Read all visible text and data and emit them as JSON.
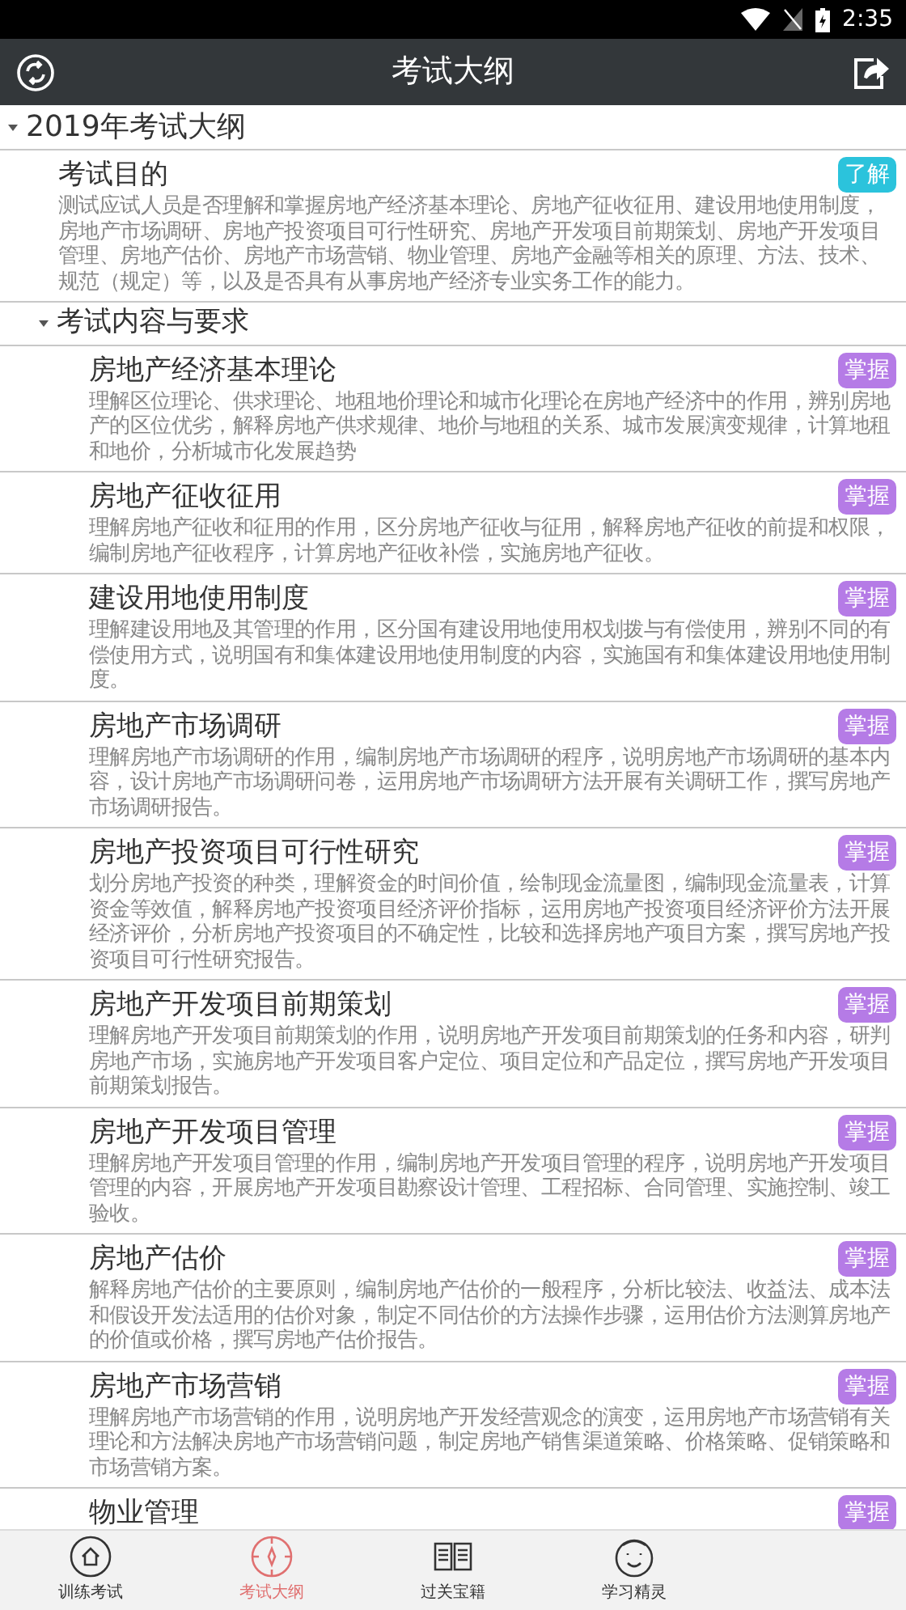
{
  "status_bar": {
    "time": "2:35"
  },
  "toolbar": {
    "title": "考试大纲"
  },
  "outline": [
    {
      "kind": "group",
      "title": "2019年考试大纲",
      "expanded": true,
      "children": [
        {
          "kind": "topic",
          "title": "考试目的",
          "tag": {
            "text": "了解",
            "color": "#2bc3dc"
          },
          "description": "测试应试人员是否理解和掌握房地产经济基本理论、房地产征收征用、建设用地使用制度，房地产市场调研、房地产投资项目可行性研究、房地产开发项目前期策划、房地产开发项目管理、房地产估价、房地产市场营销、物业管理、房地产金融等相关的原理、方法、技术、规范（规定）等，以及是否具有从事房地产经济专业实务工作的能力。"
        },
        {
          "kind": "group",
          "title": "考试内容与要求",
          "expanded": true,
          "children": [
            {
              "kind": "topic",
              "title": "房地产经济基本理论",
              "tag": {
                "text": "掌握",
                "color": "#b57be6"
              },
              "description": "理解区位理论、供求理论、地租地价理论和城市化理论在房地产经济中的作用，辨别房地产的区位优劣，解释房地产供求规律、地价与地租的关系、城市发展演变规律，计算地租和地价，分析城市化发展趋势"
            },
            {
              "kind": "topic",
              "title": "房地产征收征用",
              "tag": {
                "text": "掌握",
                "color": "#b57be6"
              },
              "description": "理解房地产征收和征用的作用，区分房地产征收与征用，解释房地产征收的前提和权限，编制房地产征收程序，计算房地产征收补偿，实施房地产征收。"
            },
            {
              "kind": "topic",
              "title": "建设用地使用制度",
              "tag": {
                "text": "掌握",
                "color": "#b57be6"
              },
              "description": "理解建设用地及其管理的作用，区分国有建设用地使用权划拨与有偿使用，辨别不同的有偿使用方式，说明国有和集体建设用地使用制度的内容，实施国有和集体建设用地使用制度。"
            },
            {
              "kind": "topic",
              "title": "房地产市场调研",
              "tag": {
                "text": "掌握",
                "color": "#b57be6"
              },
              "description": "理解房地产市场调研的作用，编制房地产市场调研的程序，说明房地产市场调研的基本内容，设计房地产市场调研问卷，运用房地产市场调研方法开展有关调研工作，撰写房地产市场调研报告。"
            },
            {
              "kind": "topic",
              "title": "房地产投资项目可行性研究",
              "tag": {
                "text": "掌握",
                "color": "#b57be6"
              },
              "description": "划分房地产投资的种类，理解资金的时间价值，绘制现金流量图，编制现金流量表，计算资金等效值，解释房地产投资项目经济评价指标，运用房地产投资项目经济评价方法开展经济评价，分析房地产投资项目的不确定性，比较和选择房地产项目方案，撰写房地产投资项目可行性研究报告。"
            },
            {
              "kind": "topic",
              "title": "房地产开发项目前期策划",
              "tag": {
                "text": "掌握",
                "color": "#b57be6"
              },
              "description": "理解房地产开发项目前期策划的作用，说明房地产开发项目前期策划的任务和内容，研判房地产市场，实施房地产开发项目客户定位、项目定位和产品定位，撰写房地产开发项目前期策划报告。"
            },
            {
              "kind": "topic",
              "title": "房地产开发项目管理",
              "tag": {
                "text": "掌握",
                "color": "#b57be6"
              },
              "description": "理解房地产开发项目管理的作用，编制房地产开发项目管理的程序，说明房地产开发项目管理的内容，开展房地产开发项目勘察设计管理、工程招标、合同管理、实施控制、竣工验收。"
            },
            {
              "kind": "topic",
              "title": "房地产估价",
              "tag": {
                "text": "掌握",
                "color": "#b57be6"
              },
              "description": "解释房地产估价的主要原则，编制房地产估价的一般程序，分析比较法、收益法、成本法和假设开发法适用的估价对象，制定不同估价的方法操作步骤，运用估价方法测算房地产的价值或价格，撰写房地产估价报告。"
            },
            {
              "kind": "topic",
              "title": "房地产市场营销",
              "tag": {
                "text": "掌握",
                "color": "#b57be6"
              },
              "description": "理解房地产市场营销的作用，说明房地产开发经营观念的演变，运用房地产市场营销有关理论和方法解决房地产市场营销问题，制定房地产销售渠道策略、价格策略、促销策略和市场营销方案。"
            },
            {
              "kind": "topic",
              "title": "物业管理",
              "tag": {
                "text": "掌握",
                "color": "#b57be6"
              }
            }
          ]
        }
      ]
    }
  ],
  "tab_bar": [
    {
      "label": "训练考试",
      "selected": false
    },
    {
      "label": "考试大纲",
      "selected": true
    },
    {
      "label": "过关宝籍",
      "selected": false
    },
    {
      "label": "学习精灵",
      "selected": false
    }
  ]
}
